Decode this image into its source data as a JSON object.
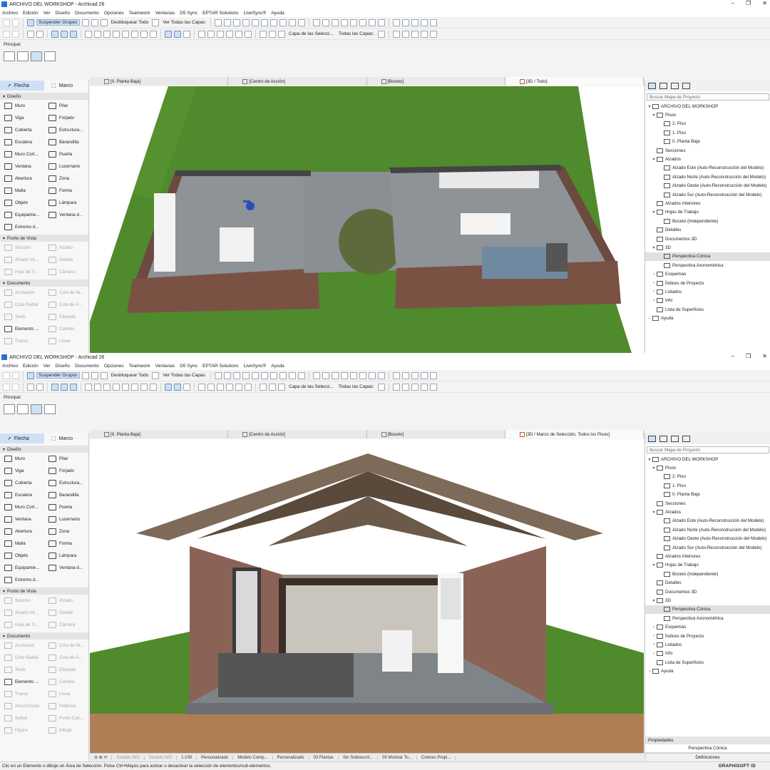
{
  "window": {
    "title": "ARCHIVO DEL WORKSHOP - Archicad 26"
  },
  "menu": [
    "Archivo",
    "Edición",
    "Ver",
    "Diseño",
    "Documento",
    "Opciones",
    "Teamwork",
    "Ventanas",
    "D5 Sync",
    "EPTAR Solutions",
    "LiveSync®",
    "Ayuda"
  ],
  "toolbar": {
    "suspend_groups": "Suspender Grupos",
    "unlock_all": "Desbloquear Todo",
    "show_all_layers": "Ver Todas las Capas",
    "layer_selection": "Capa de las Selecci...",
    "all_layers": "Todas las Capas:"
  },
  "principal": {
    "label": "Principal:"
  },
  "toolbox": {
    "arrow": "Flecha",
    "marquee": "Marco",
    "design_header": "Diseño",
    "design_tools": [
      "Muro",
      "Pilar",
      "Viga",
      "Forjado",
      "Cubierta",
      "Estructura...",
      "Escalera",
      "Barandilla",
      "Muro Cort...",
      "Puerta",
      "Ventana",
      "Lucernario",
      "Abertura",
      "Zona",
      "Malla",
      "Forma",
      "Objeto",
      "Lámpara",
      "Equipamie...",
      "Ventana d...",
      "Extremo d..."
    ],
    "viewpoint_header": "Punto de Vista",
    "viewpoint_tools": [
      "Sección",
      "Alzado",
      "Alzado Int...",
      "Detalle",
      "Hoja de Tr...",
      "Cámara"
    ],
    "document_header": "Documento",
    "document_tools_top": [
      "Acotación",
      "Cota de Ni...",
      "Cota Radial",
      "Cota de Á...",
      "Texto",
      "Etiqueta",
      "Elemento ...",
      "Cambio",
      "Trama",
      "Línea"
    ],
    "document_tools_bottom": [
      "Acotación",
      "Cota de Ni...",
      "Cota Radial",
      "Cota de Á...",
      "Texto",
      "Etiqueta",
      "Elemento ...",
      "Cambio",
      "Trama",
      "Línea",
      "Arco/Círculo",
      "Polilínea",
      "Spline",
      "Punto Cali...",
      "Figura",
      "Dibujo"
    ]
  },
  "tabs_top": [
    "[0. Planta Baja]",
    "[Centro de Acción]",
    "[Boceto]",
    "[3D / Todo]"
  ],
  "tabs_bottom": [
    "[0. Planta Baja]",
    "[Centro de Acción]",
    "[Boceto]",
    "[3D / Marco de Selección, Todos los Pisos]"
  ],
  "navigator": {
    "search_placeholder": "Buscar Mapa de Proyecto",
    "tree": [
      {
        "label": "ARCHIVO DEL WORKSHOP",
        "level": 0,
        "toggle": "▾"
      },
      {
        "label": "Pisos",
        "level": 1,
        "toggle": "▾"
      },
      {
        "label": "2. Piso",
        "level": 2,
        "toggle": ""
      },
      {
        "label": "1. Piso",
        "level": 2,
        "toggle": ""
      },
      {
        "label": "0. Planta Baja",
        "level": 2,
        "toggle": ""
      },
      {
        "label": "Secciones",
        "level": 1,
        "toggle": ""
      },
      {
        "label": "Alzados",
        "level": 1,
        "toggle": "▾"
      },
      {
        "label": "Alzado Este (Auto-Reconstrucción del Modelo)",
        "level": 2,
        "toggle": ""
      },
      {
        "label": "Alzado Norte (Auto-Reconstrucción del Modelo)",
        "level": 2,
        "toggle": ""
      },
      {
        "label": "Alzado Oeste (Auto-Reconstrucción del Modelo)",
        "level": 2,
        "toggle": ""
      },
      {
        "label": "Alzado Sur (Auto-Reconstrucción del Modelo)",
        "level": 2,
        "toggle": ""
      },
      {
        "label": "Alzados Interiores",
        "level": 1,
        "toggle": ""
      },
      {
        "label": "Hojas de Trabajo",
        "level": 1,
        "toggle": "▾"
      },
      {
        "label": "Boceto (Independiente)",
        "level": 2,
        "toggle": ""
      },
      {
        "label": "Detalles",
        "level": 1,
        "toggle": ""
      },
      {
        "label": "Documentos 3D",
        "level": 1,
        "toggle": ""
      },
      {
        "label": "3D",
        "level": 1,
        "toggle": "▾"
      },
      {
        "label": "Perspectiva Cónica",
        "level": 2,
        "toggle": "",
        "selected": true
      },
      {
        "label": "Perspectiva Axonométrica",
        "level": 2,
        "toggle": ""
      },
      {
        "label": "Esquemas",
        "level": 1,
        "toggle": "›"
      },
      {
        "label": "Índices de Proyecto",
        "level": 1,
        "toggle": "›"
      },
      {
        "label": "Listados",
        "level": 1,
        "toggle": "›"
      },
      {
        "label": "Info",
        "level": 1,
        "toggle": "›"
      },
      {
        "label": "Lista de Superficies",
        "level": 1,
        "toggle": ""
      },
      {
        "label": "Ayuda",
        "level": 0,
        "toggle": "›"
      }
    ],
    "properties_header": "Propiedades",
    "properties_value": "Perspectiva Cónica",
    "definitions": "Definiciones"
  },
  "statusbar": [
    "Sentido N/D",
    "Sentido N/D",
    "1:100",
    "Personalizado",
    "Modelo Comp...",
    "Personalizado",
    "03 Plantas",
    "Sin Sobrescrit...",
    "00 Mostrar To...",
    "Colores Propi..."
  ],
  "hint": "Clic en un Elemento o dibuje un Área de Selección. Pulse Ctrl+Mayús para activar o desactivar la selección de elementos/sub-elementos.",
  "brand": "GRAPHISOFT ID",
  "colors": {
    "grass": "#4f8a2c",
    "brick": "#7a5244",
    "floor": "#8e9398",
    "timber": "#5a4a3c",
    "highlight": "#cfe0f5"
  }
}
